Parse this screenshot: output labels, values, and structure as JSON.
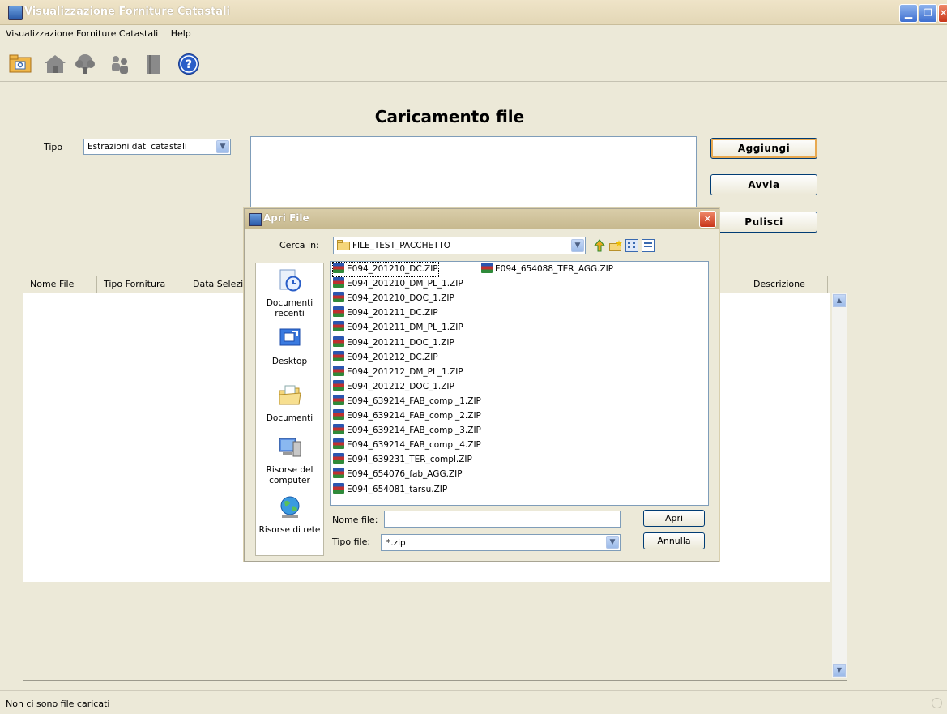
{
  "window": {
    "title": "Visualizzazione Forniture Catastali"
  },
  "menu": {
    "items": [
      "Visualizzazione Forniture Catastali",
      "Help"
    ]
  },
  "toolbar": {
    "icons": [
      "open-folder-icon",
      "house-icon",
      "tree-icon",
      "people-icon",
      "book-icon",
      "help-icon"
    ]
  },
  "main": {
    "title": "Caricamento file",
    "tipo_label": "Tipo",
    "tipo_value": "Estrazioni dati catastali",
    "buttons": {
      "add": "Aggiungi",
      "start": "Avvia",
      "clear": "Pulisci"
    }
  },
  "table": {
    "columns": [
      "Nome File",
      "Tipo Fornitura",
      "Data Selezion",
      "Descrizione"
    ]
  },
  "status": {
    "text": "Non ci sono file caricati"
  },
  "dialog": {
    "title": "Apri File",
    "look_in_label": "Cerca in:",
    "look_in_value": "FILE_TEST_PACCHETTO",
    "places": [
      "Documenti recenti",
      "Desktop",
      "Documenti",
      "Risorse del computer",
      "Risorse di rete"
    ],
    "files_col1": [
      "E094_201210_DC.ZIP",
      "E094_201210_DM_PL_1.ZIP",
      "E094_201210_DOC_1.ZIP",
      "E094_201211_DC.ZIP",
      "E094_201211_DM_PL_1.ZIP",
      "E094_201211_DOC_1.ZIP",
      "E094_201212_DC.ZIP",
      "E094_201212_DM_PL_1.ZIP",
      "E094_201212_DOC_1.ZIP",
      "E094_639214_FAB_compl_1.ZIP",
      "E094_639214_FAB_compl_2.ZIP",
      "E094_639214_FAB_compl_3.ZIP",
      "E094_639214_FAB_compl_4.ZIP",
      "E094_639231_TER_compl.ZIP",
      "E094_654076_fab_AGG.ZIP",
      "E094_654081_tarsu.ZIP"
    ],
    "files_col2": [
      "E094_654088_TER_AGG.ZIP"
    ],
    "filename_label": "Nome file:",
    "filename_value": "",
    "filetype_label": "Tipo file:",
    "filetype_value": "*.zip",
    "open_button": "Apri",
    "cancel_button": "Annulla"
  }
}
